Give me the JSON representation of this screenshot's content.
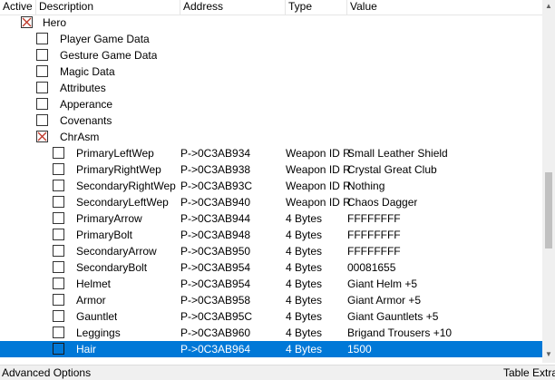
{
  "columns": {
    "active": "Active",
    "description": "Description",
    "address": "Address",
    "type": "Type",
    "value": "Value"
  },
  "rows": [
    {
      "description": "Hero",
      "address": "",
      "type": "",
      "value": "",
      "checked": true,
      "level": 0,
      "selected": false
    },
    {
      "description": "Player Game Data",
      "address": "",
      "type": "",
      "value": "",
      "checked": false,
      "level": 1,
      "selected": false
    },
    {
      "description": "Gesture Game Data",
      "address": "",
      "type": "",
      "value": "",
      "checked": false,
      "level": 1,
      "selected": false
    },
    {
      "description": "Magic Data",
      "address": "",
      "type": "",
      "value": "",
      "checked": false,
      "level": 1,
      "selected": false
    },
    {
      "description": "Attributes",
      "address": "",
      "type": "",
      "value": "",
      "checked": false,
      "level": 1,
      "selected": false
    },
    {
      "description": "Apperance",
      "address": "",
      "type": "",
      "value": "",
      "checked": false,
      "level": 1,
      "selected": false
    },
    {
      "description": "Covenants",
      "address": "",
      "type": "",
      "value": "",
      "checked": false,
      "level": 1,
      "selected": false
    },
    {
      "description": "ChrAsm",
      "address": "",
      "type": "",
      "value": "",
      "checked": true,
      "level": 1,
      "selected": false
    },
    {
      "description": "PrimaryLeftWep",
      "address": "P->0C3AB934",
      "type": "Weapon ID R",
      "value": "Small Leather Shield",
      "checked": false,
      "level": 2,
      "selected": false
    },
    {
      "description": "PrimaryRightWep",
      "address": "P->0C3AB938",
      "type": "Weapon ID R",
      "value": "Crystal Great Club",
      "checked": false,
      "level": 2,
      "selected": false
    },
    {
      "description": "SecondaryRightWep",
      "address": "P->0C3AB93C",
      "type": "Weapon ID R",
      "value": "Nothing",
      "checked": false,
      "level": 2,
      "selected": false
    },
    {
      "description": "SecondaryLeftWep",
      "address": "P->0C3AB940",
      "type": "Weapon ID R",
      "value": "Chaos Dagger",
      "checked": false,
      "level": 2,
      "selected": false
    },
    {
      "description": "PrimaryArrow",
      "address": "P->0C3AB944",
      "type": "4 Bytes",
      "value": "FFFFFFFF",
      "checked": false,
      "level": 2,
      "selected": false
    },
    {
      "description": "PrimaryBolt",
      "address": "P->0C3AB948",
      "type": "4 Bytes",
      "value": "FFFFFFFF",
      "checked": false,
      "level": 2,
      "selected": false
    },
    {
      "description": "SecondaryArrow",
      "address": "P->0C3AB950",
      "type": "4 Bytes",
      "value": "FFFFFFFF",
      "checked": false,
      "level": 2,
      "selected": false
    },
    {
      "description": "SecondaryBolt",
      "address": "P->0C3AB954",
      "type": "4 Bytes",
      "value": "00081655",
      "checked": false,
      "level": 2,
      "selected": false
    },
    {
      "description": "Helmet",
      "address": "P->0C3AB954",
      "type": "4 Bytes",
      "value": "Giant Helm +5",
      "checked": false,
      "level": 2,
      "selected": false
    },
    {
      "description": "Armor",
      "address": "P->0C3AB958",
      "type": "4 Bytes",
      "value": "Giant Armor +5",
      "checked": false,
      "level": 2,
      "selected": false
    },
    {
      "description": "Gauntlet",
      "address": "P->0C3AB95C",
      "type": "4 Bytes",
      "value": "Giant Gauntlets +5",
      "checked": false,
      "level": 2,
      "selected": false
    },
    {
      "description": "Leggings",
      "address": "P->0C3AB960",
      "type": "4 Bytes",
      "value": "Brigand Trousers +10",
      "checked": false,
      "level": 2,
      "selected": false
    },
    {
      "description": "Hair",
      "address": "P->0C3AB964",
      "type": "4 Bytes",
      "value": "1500",
      "checked": false,
      "level": 2,
      "selected": true
    }
  ],
  "footer": {
    "advanced": "Advanced Options",
    "extras": "Table Extras"
  },
  "colors": {
    "selection": "#0078d7",
    "cross": "#c0392b"
  }
}
